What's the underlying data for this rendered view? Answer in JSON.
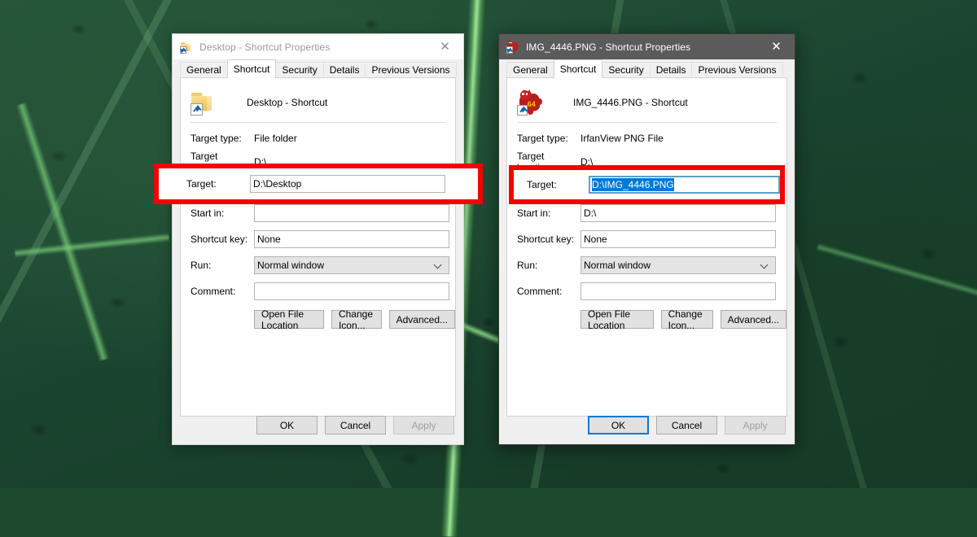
{
  "background": {
    "description": "dark-green-leaf-texture",
    "base_color": "#1d4730",
    "vein_color": "#8ee08a"
  },
  "annotation": {
    "color": "#f40000",
    "shape": "rectangle-outline",
    "count": 2
  },
  "dialogs": [
    {
      "id": "left",
      "active": false,
      "title": "Desktop - Shortcut Properties",
      "title_icon": "folder-shortcut-icon",
      "close_label": "✕",
      "tabs": [
        {
          "label": "General",
          "selected": false
        },
        {
          "label": "Shortcut",
          "selected": true
        },
        {
          "label": "Security",
          "selected": false
        },
        {
          "label": "Details",
          "selected": false
        },
        {
          "label": "Previous Versions",
          "selected": false
        }
      ],
      "header": {
        "icon": "folder-shortcut-icon",
        "name": "Desktop - Shortcut"
      },
      "fields": {
        "target_type_label": "Target type:",
        "target_type_value": "File folder",
        "target_location_label": "Target location:",
        "target_location_value": "D:\\",
        "target_label": "Target:",
        "target_value": "D:\\Desktop",
        "target_selected": false,
        "start_in_label": "Start in:",
        "start_in_value": "",
        "shortcut_key_label": "Shortcut key:",
        "shortcut_key_value": "None",
        "run_label": "Run:",
        "run_value": "Normal window",
        "comment_label": "Comment:",
        "comment_value": ""
      },
      "action_buttons": {
        "open_file_location": "Open File Location",
        "change_icon": "Change Icon...",
        "advanced": "Advanced..."
      },
      "footer": {
        "ok": "OK",
        "cancel": "Cancel",
        "apply": "Apply",
        "ok_focused": false,
        "apply_disabled": true
      }
    },
    {
      "id": "right",
      "active": true,
      "title": "IMG_4446.PNG - Shortcut Properties",
      "title_icon": "irfanview-shortcut-icon",
      "close_label": "✕",
      "tabs": [
        {
          "label": "General",
          "selected": false
        },
        {
          "label": "Shortcut",
          "selected": true
        },
        {
          "label": "Security",
          "selected": false
        },
        {
          "label": "Details",
          "selected": false
        },
        {
          "label": "Previous Versions",
          "selected": false
        }
      ],
      "header": {
        "icon": "irfanview-shortcut-icon",
        "icon_badge": "64",
        "name": "IMG_4446.PNG - Shortcut"
      },
      "fields": {
        "target_type_label": "Target type:",
        "target_type_value": "IrfanView PNG File",
        "target_location_label": "Target location:",
        "target_location_value": "D:\\",
        "target_label": "Target:",
        "target_value": "D:\\IMG_4446.PNG",
        "target_selected": true,
        "start_in_label": "Start in:",
        "start_in_value": "D:\\",
        "shortcut_key_label": "Shortcut key:",
        "shortcut_key_value": "None",
        "run_label": "Run:",
        "run_value": "Normal window",
        "comment_label": "Comment:",
        "comment_value": ""
      },
      "action_buttons": {
        "open_file_location": "Open File Location",
        "change_icon": "Change Icon...",
        "advanced": "Advanced..."
      },
      "footer": {
        "ok": "OK",
        "cancel": "Cancel",
        "apply": "Apply",
        "ok_focused": true,
        "apply_disabled": true
      }
    }
  ],
  "colors": {
    "selection_blue": "#0078d7",
    "focus_blue": "#5b9ec9",
    "annotation_red": "#f40000",
    "active_titlebar": "#5b5b5b",
    "inactive_titlebar": "#ffffff"
  }
}
